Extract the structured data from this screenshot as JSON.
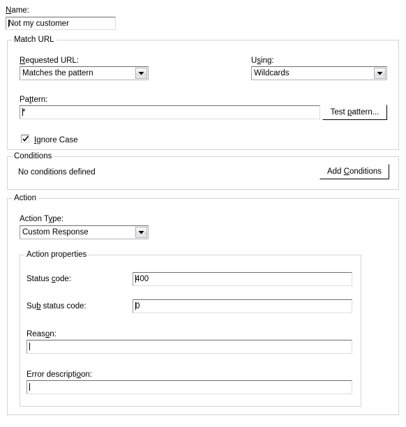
{
  "form": {
    "name_label": "Name:",
    "name_value": "Not my customer"
  },
  "match_url": {
    "title": "Match URL",
    "requested_url_label": "Requested URL:",
    "requested_url_value": "Matches the pattern",
    "using_label": "Using:",
    "using_value": "Wildcards",
    "pattern_label": "Pattern:",
    "pattern_value": "*",
    "test_pattern_button": "Test pattern...",
    "ignore_case_label": "Ignore Case",
    "ignore_case_checked": true
  },
  "conditions": {
    "title": "Conditions",
    "empty_text": "No conditions defined",
    "add_button": "Add Conditions"
  },
  "action": {
    "title": "Action",
    "action_type_label": "Action Type:",
    "action_type_value": "Custom Response",
    "properties": {
      "title": "Action properties",
      "status_code_label": "Status code:",
      "status_code_value": "400",
      "sub_status_code_label": "Sub status code:",
      "sub_status_code_value": "0",
      "reason_label": "Reason:",
      "reason_value": "",
      "error_description_label": "Error description:",
      "error_description_value": ""
    }
  },
  "icons": {
    "dropdown": "chevron-down-icon",
    "checkmark": "check-icon"
  },
  "colors": {
    "background": "#ffffff",
    "group_border": "#d4d4d4",
    "field_border_top": "#6e6e6e",
    "text": "#000000"
  }
}
